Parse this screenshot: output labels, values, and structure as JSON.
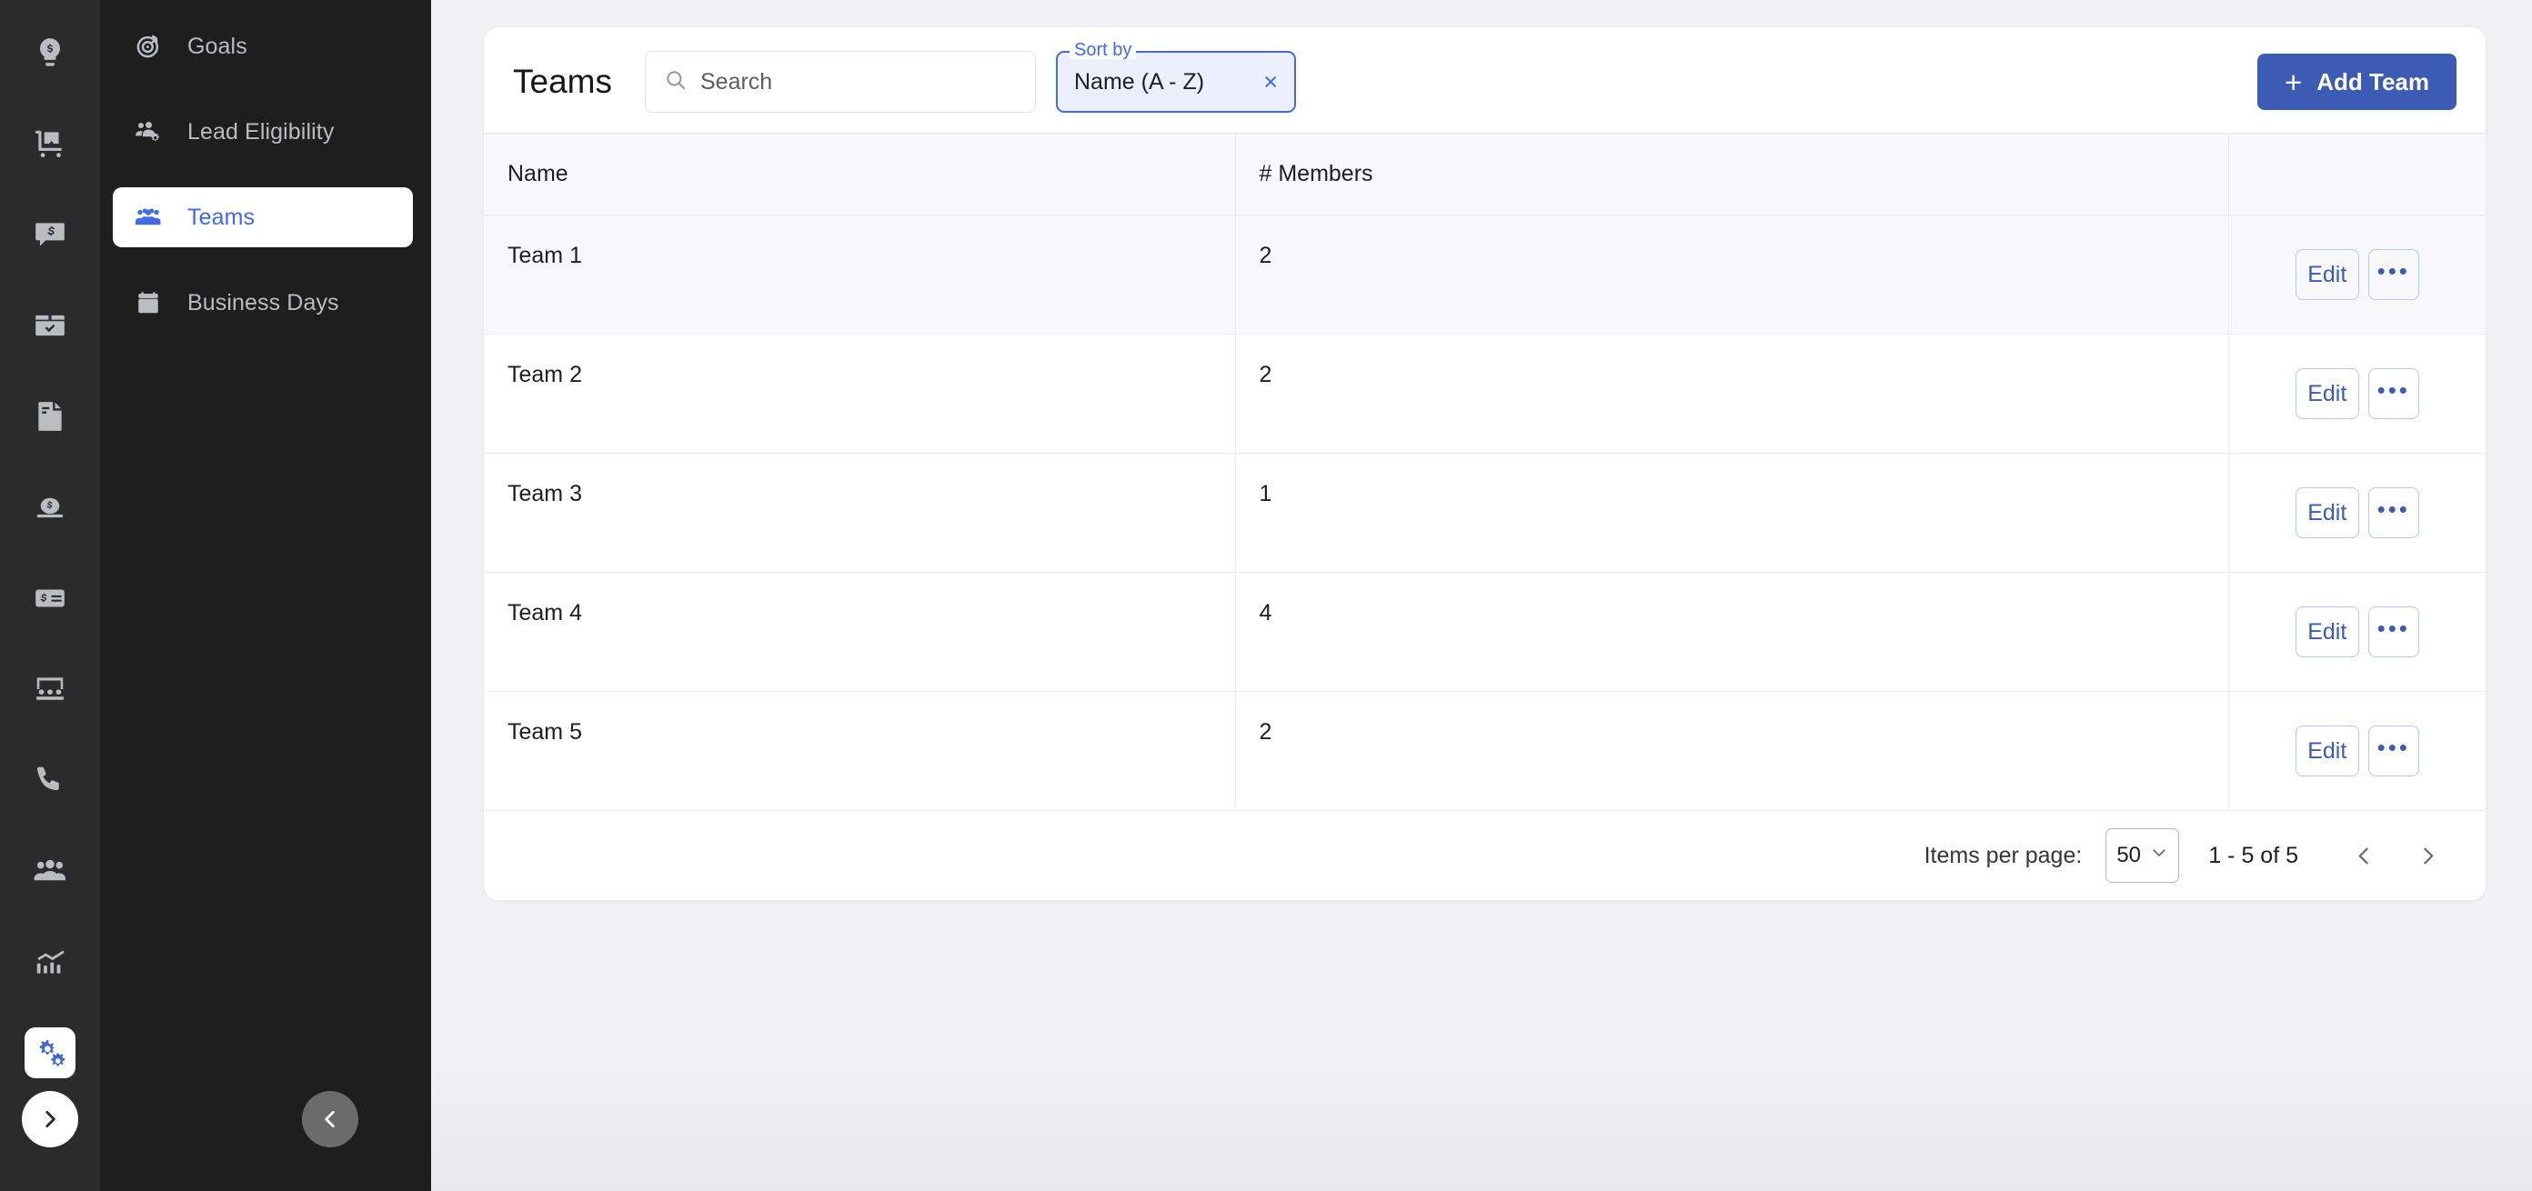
{
  "icon_rail": {
    "items": [
      {
        "icon": "lightbulb-dollar-icon",
        "name": "rail-item-opportunities"
      },
      {
        "icon": "delivery-cart-icon",
        "name": "rail-item-deliveries"
      },
      {
        "icon": "chat-dollar-icon",
        "name": "rail-item-quotes"
      },
      {
        "icon": "box-check-icon",
        "name": "rail-item-orders"
      },
      {
        "icon": "invoice-dollar-icon",
        "name": "rail-item-invoices"
      },
      {
        "icon": "money-bag-icon",
        "name": "rail-item-payments"
      },
      {
        "icon": "check-payment-icon",
        "name": "rail-item-checks"
      },
      {
        "icon": "meeting-table-icon",
        "name": "rail-item-meetings"
      },
      {
        "icon": "phone-icon",
        "name": "rail-item-calls"
      },
      {
        "icon": "people-group-icon",
        "name": "rail-item-contacts"
      },
      {
        "icon": "bar-chart-icon",
        "name": "rail-item-reports"
      },
      {
        "icon": "gears-icon",
        "name": "rail-item-settings",
        "active": true
      }
    ],
    "expand_icon": "chevron-right-icon"
  },
  "sidebar": {
    "items": [
      {
        "label": "Goals",
        "icon": "target-icon",
        "active": false
      },
      {
        "label": "Lead Eligibility",
        "icon": "users-gear-icon",
        "active": false
      },
      {
        "label": "Teams",
        "icon": "team-icon",
        "active": true
      },
      {
        "label": "Business Days",
        "icon": "calendar-icon",
        "active": false
      }
    ],
    "collapse_icon": "chevron-left-icon"
  },
  "header": {
    "title": "Teams",
    "search": {
      "placeholder": "Search",
      "value": "",
      "icon": "search-icon"
    },
    "sort_by": {
      "legend": "Sort by",
      "value": "Name (A - Z)",
      "clear_icon": "close-icon",
      "clear_glyph": "×"
    },
    "add_button": {
      "label": "Add Team",
      "icon": "plus-icon",
      "glyph": "+",
      "color": "#3b5bb5"
    }
  },
  "table": {
    "columns": [
      "Name",
      "# Members",
      ""
    ],
    "rows": [
      {
        "name": "Team 1",
        "members": "2",
        "edit": "Edit",
        "more": "•••"
      },
      {
        "name": "Team 2",
        "members": "2",
        "edit": "Edit",
        "more": "•••"
      },
      {
        "name": "Team 3",
        "members": "1",
        "edit": "Edit",
        "more": "•••"
      },
      {
        "name": "Team 4",
        "members": "4",
        "edit": "Edit",
        "more": "•••"
      },
      {
        "name": "Team 5",
        "members": "2",
        "edit": "Edit",
        "more": "•••"
      }
    ]
  },
  "paginator": {
    "items_per_page_label": "Items per page:",
    "items_per_page_value": "50",
    "range_label": "1 - 5 of 5",
    "prev_icon": "chevron-left-icon",
    "next_icon": "chevron-right-icon",
    "dropdown_icon": "chevron-down-icon"
  },
  "colors": {
    "accent": "#4169e8",
    "button": "#3b5bb5",
    "rail_bg": "#2b2b2b",
    "sidebar_bg": "#1e1e1e",
    "page_bg": "#f1f1f5"
  }
}
